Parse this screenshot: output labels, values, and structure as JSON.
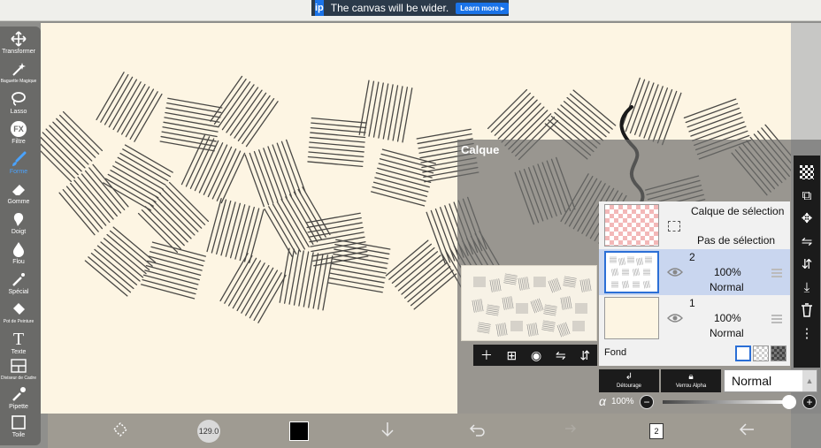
{
  "ad": {
    "text": "The canvas will be wider.",
    "button": "Learn more ▸",
    "logo": "ip"
  },
  "tools": [
    {
      "label": "Transformer",
      "icon": "move-icon"
    },
    {
      "label": "Baguette Magique",
      "icon": "magic-wand-icon"
    },
    {
      "label": "Lasso",
      "icon": "lasso-icon"
    },
    {
      "label": "Filtre",
      "icon": "fx-icon",
      "glyph": "FX"
    },
    {
      "label": "Forme",
      "icon": "brush-icon"
    },
    {
      "label": "Gomme",
      "icon": "eraser-icon"
    },
    {
      "label": "Doigt",
      "icon": "smudge-icon"
    },
    {
      "label": "Flou",
      "icon": "blur-icon"
    },
    {
      "label": "Spécial",
      "icon": "special-brush-icon"
    },
    {
      "label": "Pot de Peinture",
      "icon": "bucket-icon"
    },
    {
      "label": "Texte",
      "icon": "text-icon",
      "glyph": "T"
    },
    {
      "label": "Diviseur de Cadre",
      "icon": "frame-divider-icon"
    },
    {
      "label": "Pipette",
      "icon": "eyedropper-icon"
    },
    {
      "label": "Toile",
      "icon": "canvas-icon"
    }
  ],
  "bottom_bar": {
    "brush_size": "129.0",
    "color": "#000000",
    "layer_count": "2"
  },
  "panel": {
    "title": "Calque",
    "selection_layer": {
      "title": "Calque de sélection",
      "status": "Pas de sélection"
    },
    "layers": [
      {
        "number": "2",
        "opacity": "100%",
        "mode": "Normal",
        "selected": true
      },
      {
        "number": "1",
        "opacity": "100%",
        "mode": "Normal",
        "selected": false
      }
    ],
    "background_label": "Fond",
    "clipping_label": "Détourage",
    "alpha_lock_label": "Verrou Alpha",
    "blend_mode": "Normal",
    "alpha_symbol": "α",
    "opacity_value": "100%",
    "minus": "−",
    "plus": "+"
  },
  "colors": {
    "canvas": "#fdf5e3",
    "accent": "#2b6fd6",
    "panel_dark": "#1b1b1b"
  }
}
